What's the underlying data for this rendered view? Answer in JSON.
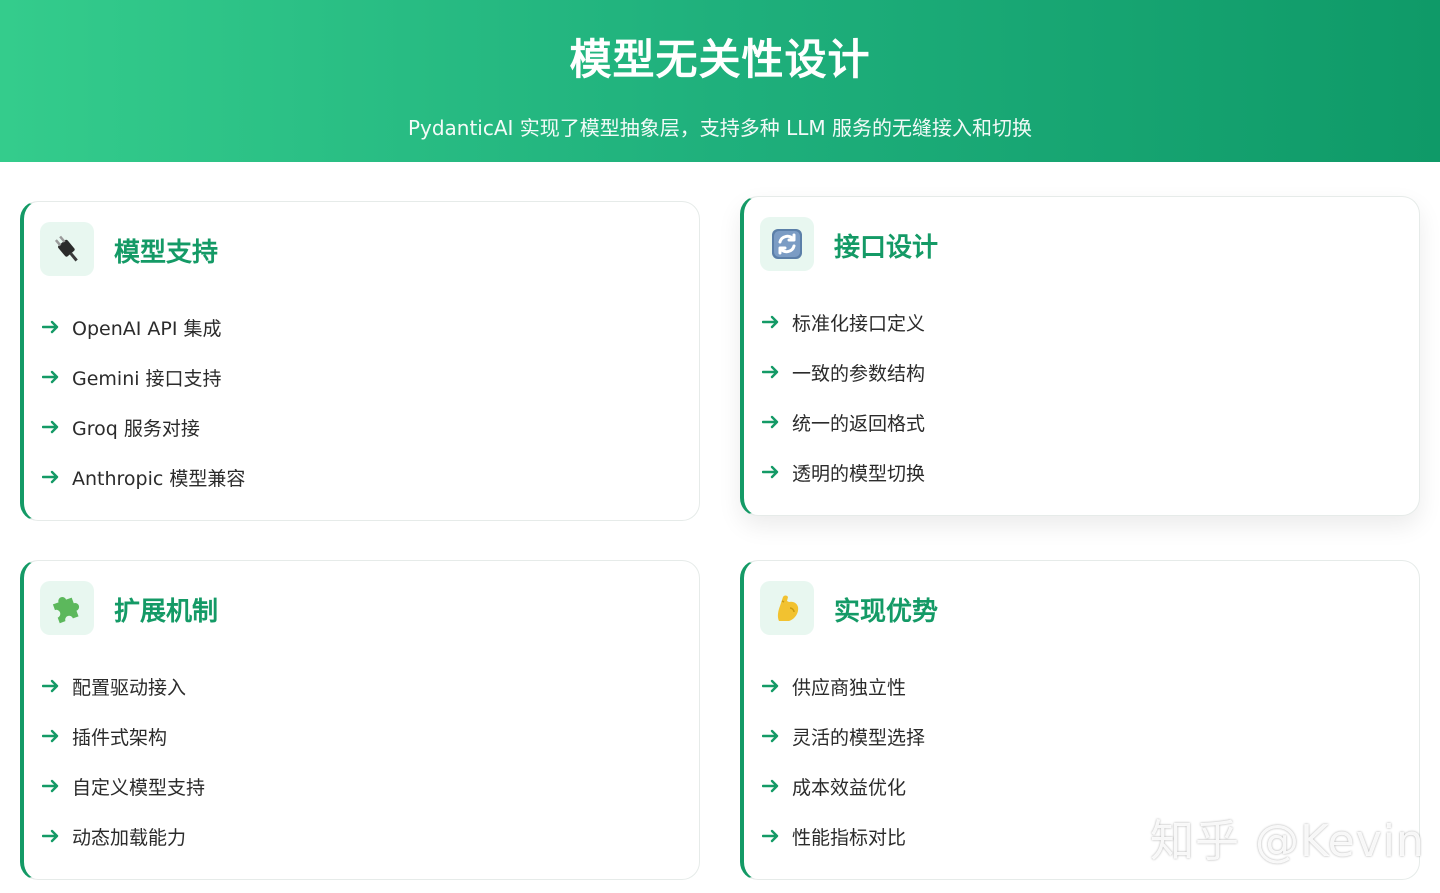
{
  "header": {
    "title": "模型无关性设计",
    "subtitle": "PydanticAI 实现了模型抽象层，支持多种 LLM 服务的无缝接入和切换"
  },
  "colors": {
    "accent": "#149a66",
    "header_start": "#34cc8c",
    "header_end": "#0f9a68",
    "icon_bg": "#e8f7f0"
  },
  "cards": [
    {
      "icon": "plug-icon",
      "title": "模型支持",
      "items": [
        "OpenAI API 集成",
        "Gemini 接口支持",
        "Groq 服务对接",
        "Anthropic 模型兼容"
      ]
    },
    {
      "icon": "refresh-icon",
      "title": "接口设计",
      "items": [
        "标准化接口定义",
        "一致的参数结构",
        "统一的返回格式",
        "透明的模型切换"
      ]
    },
    {
      "icon": "puzzle-icon",
      "title": "扩展机制",
      "items": [
        "配置驱动接入",
        "插件式架构",
        "自定义模型支持",
        "动态加载能力"
      ]
    },
    {
      "icon": "muscle-icon",
      "title": "实现优势",
      "items": [
        "供应商独立性",
        "灵活的模型选择",
        "成本效益优化",
        "性能指标对比"
      ]
    }
  ],
  "watermark": "知乎 @Kevin"
}
